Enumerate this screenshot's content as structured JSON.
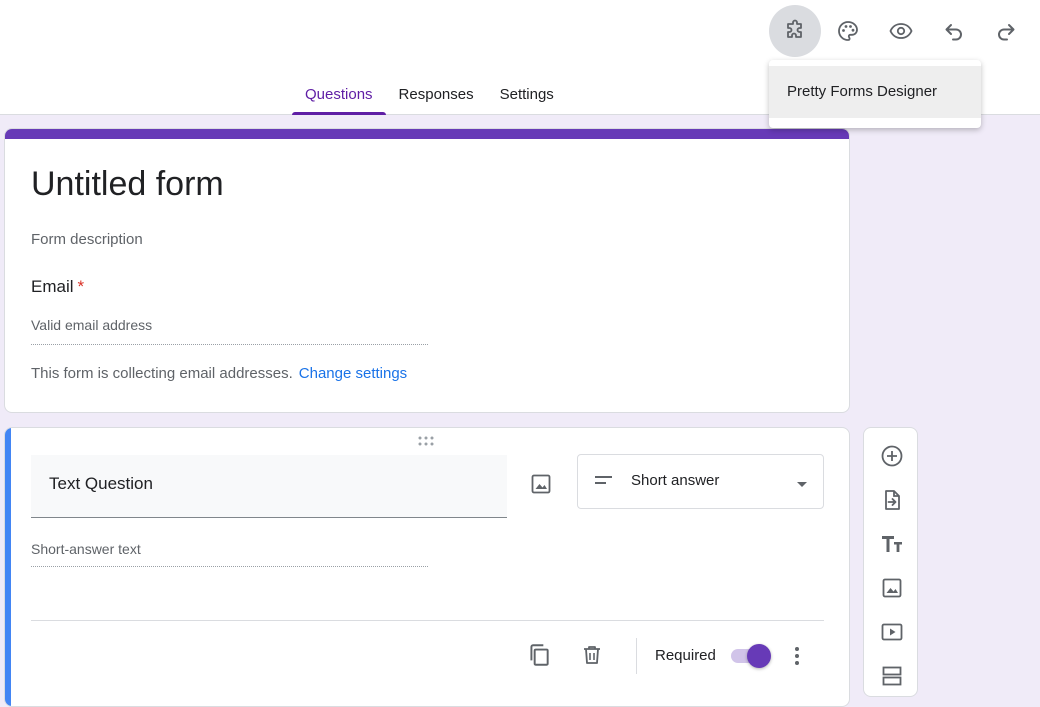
{
  "toolbar": {
    "icons": [
      "puzzle-icon",
      "palette-icon",
      "eye-icon",
      "undo-icon",
      "redo-icon"
    ]
  },
  "tabs": [
    {
      "label": "Questions",
      "active": true
    },
    {
      "label": "Responses",
      "active": false
    },
    {
      "label": "Settings",
      "active": false
    }
  ],
  "addon_menu": {
    "items": [
      "Pretty Forms Designer"
    ]
  },
  "form": {
    "title": "Untitled form",
    "description_placeholder": "Form description",
    "email": {
      "label": "Email",
      "required_mark": "*",
      "placeholder": "Valid email address"
    },
    "collect_note": "This form is collecting email addresses.",
    "change_settings_link": "Change settings"
  },
  "question": {
    "title": "Text Question",
    "type_label": "Short answer",
    "answer_placeholder": "Short-answer text",
    "required_label": "Required",
    "required_on": true
  },
  "side_toolbar": {
    "icons": [
      "add-question-icon",
      "import-questions-icon",
      "title-text-icon",
      "add-image-icon",
      "add-video-icon",
      "add-section-icon"
    ]
  },
  "colors": {
    "accent": "#673ab7",
    "tab_active": "#5f1ea5",
    "link": "#1a73e8",
    "required_star": "#d93025",
    "question_accent": "#4285f4",
    "page_background": "#f0ebf8"
  }
}
